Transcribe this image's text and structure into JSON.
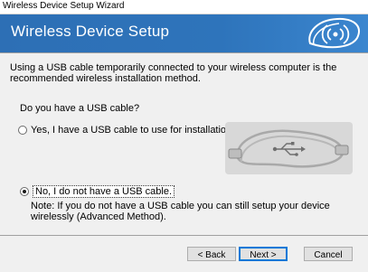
{
  "window": {
    "title": "Wireless Device Setup Wizard"
  },
  "header": {
    "title": "Wireless Device Setup",
    "logo_icon": "wireless-signal-icon"
  },
  "content": {
    "intro": "Using a USB cable temporarily connected to your wireless computer is the recommended wireless installation method.",
    "question": "Do you have a USB cable?",
    "option_yes": {
      "label": "Yes, I have a USB cable to use for installation.",
      "selected": false
    },
    "option_no": {
      "label": "No, I do not have a USB cable.",
      "selected": true
    },
    "note": "Note: If you do not have a USB cable you can still setup your device wirelessly (Advanced Method).",
    "image_icon": "usb-cable-icon"
  },
  "buttons": {
    "back": "< Back",
    "next": "Next >",
    "cancel": "Cancel"
  },
  "colors": {
    "header_blue": "#2e74bb",
    "focus_blue": "#0078d7"
  }
}
